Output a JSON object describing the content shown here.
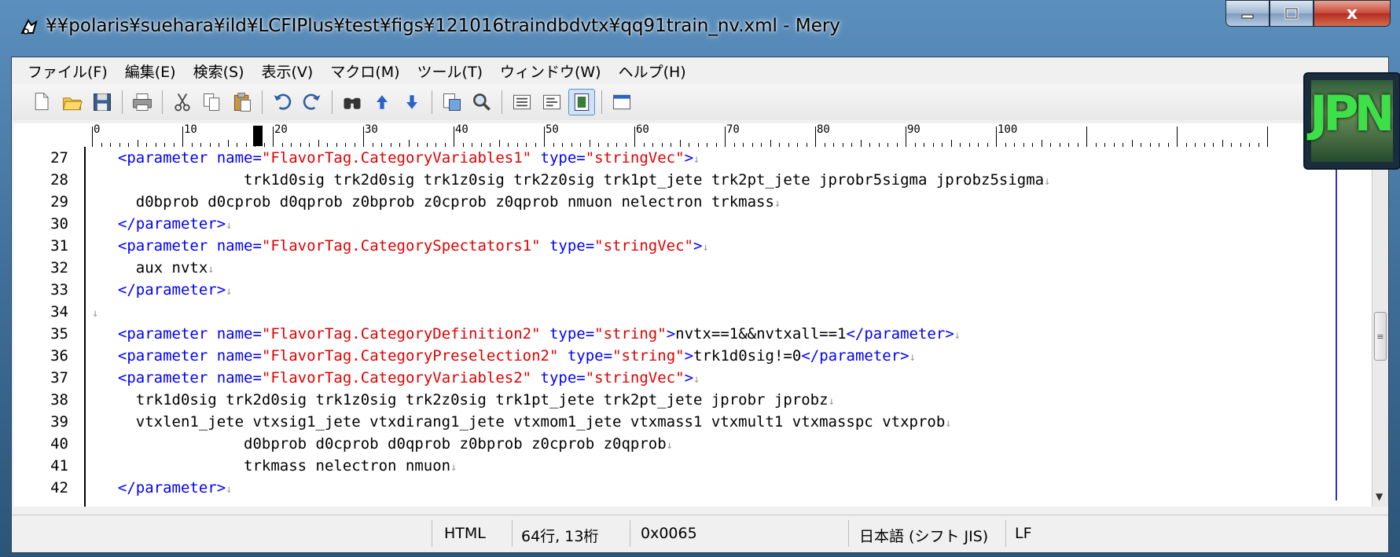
{
  "window": {
    "title": "¥¥polaris¥suehara¥ild¥LCFIPlus¥test¥figs¥121016traindbdvtx¥qq91train_nv.xml - Mery",
    "icon": "mery-app-icon"
  },
  "caption": {
    "close_label": "x"
  },
  "menu": {
    "items": [
      "ファイル(F)",
      "編集(E)",
      "検索(S)",
      "表示(V)",
      "マクロ(M)",
      "ツール(T)",
      "ウィンドウ(W)",
      "ヘルプ(H)"
    ]
  },
  "toolbar": {
    "groups": [
      [
        "new-file-icon",
        "open-folder-icon",
        "save-icon"
      ],
      [
        "print-icon"
      ],
      [
        "cut-icon",
        "copy-icon",
        "paste-icon"
      ],
      [
        "undo-icon",
        "redo-icon"
      ],
      [
        "find-icon",
        "find-prev-icon",
        "find-next-icon"
      ],
      [
        "replace-icon",
        "search-files-icon"
      ],
      [
        "wrap-none-icon",
        "wrap-window-icon",
        "wrap-ruler-icon"
      ],
      [
        "window-icon"
      ]
    ],
    "pressed": "wrap-ruler-icon"
  },
  "ruler": {
    "labels": [
      "0",
      "10",
      "20",
      "30",
      "40",
      "50",
      "60",
      "70",
      "80",
      "90",
      "100"
    ]
  },
  "editor": {
    "eol_glyph": "↓",
    "lines": [
      {
        "num": "27",
        "segs": [
          [
            "  ",
            ""
          ],
          [
            "<parameter name=",
            "tag"
          ],
          [
            "\"FlavorTag.CategoryVariables1\"",
            "str"
          ],
          [
            " type=",
            "tag"
          ],
          [
            "\"stringVec\"",
            "str"
          ],
          [
            ">",
            "tag"
          ]
        ]
      },
      {
        "num": "28",
        "segs": [
          [
            "                trk1d0sig trk2d0sig trk1z0sig trk2z0sig trk1pt_jete trk2pt_jete jprobr5sigma jprobz5sigma",
            ""
          ]
        ]
      },
      {
        "num": "29",
        "segs": [
          [
            "    d0bprob d0cprob d0qprob z0bprob z0cprob z0qprob nmuon nelectron trkmass",
            ""
          ]
        ]
      },
      {
        "num": "30",
        "segs": [
          [
            "  ",
            ""
          ],
          [
            "</parameter>",
            "tag"
          ]
        ]
      },
      {
        "num": "31",
        "segs": [
          [
            "  ",
            ""
          ],
          [
            "<parameter name=",
            "tag"
          ],
          [
            "\"FlavorTag.CategorySpectators1\"",
            "str"
          ],
          [
            " type=",
            "tag"
          ],
          [
            "\"stringVec\"",
            "str"
          ],
          [
            ">",
            "tag"
          ]
        ]
      },
      {
        "num": "32",
        "segs": [
          [
            "    aux nvtx",
            ""
          ]
        ]
      },
      {
        "num": "33",
        "segs": [
          [
            "  ",
            ""
          ],
          [
            "</parameter>",
            "tag"
          ]
        ]
      },
      {
        "num": "34",
        "segs": []
      },
      {
        "num": "35",
        "segs": [
          [
            "  ",
            ""
          ],
          [
            "<parameter name=",
            "tag"
          ],
          [
            "\"FlavorTag.CategoryDefinition2\"",
            "str"
          ],
          [
            " type=",
            "tag"
          ],
          [
            "\"string\"",
            "str"
          ],
          [
            ">",
            "tag"
          ],
          [
            "nvtx==1&&nvtxall==1",
            ""
          ],
          [
            "</parameter>",
            "tag"
          ]
        ]
      },
      {
        "num": "36",
        "segs": [
          [
            "  ",
            ""
          ],
          [
            "<parameter name=",
            "tag"
          ],
          [
            "\"FlavorTag.CategoryPreselection2\"",
            "str"
          ],
          [
            " type=",
            "tag"
          ],
          [
            "\"string\"",
            "str"
          ],
          [
            ">",
            "tag"
          ],
          [
            "trk1d0sig!=0",
            ""
          ],
          [
            "</parameter>",
            "tag"
          ]
        ]
      },
      {
        "num": "37",
        "segs": [
          [
            "  ",
            ""
          ],
          [
            "<parameter name=",
            "tag"
          ],
          [
            "\"FlavorTag.CategoryVariables2\"",
            "str"
          ],
          [
            " type=",
            "tag"
          ],
          [
            "\"stringVec\"",
            "str"
          ],
          [
            ">",
            "tag"
          ]
        ]
      },
      {
        "num": "38",
        "segs": [
          [
            "    trk1d0sig trk2d0sig trk1z0sig trk2z0sig trk1pt_jete trk2pt_jete jprobr jprobz",
            ""
          ]
        ]
      },
      {
        "num": "39",
        "segs": [
          [
            "    vtxlen1_jete vtxsig1_jete vtxdirang1_jete vtxmom1_jete vtxmass1 vtxmult1 vtxmasspc vtxprob",
            ""
          ]
        ]
      },
      {
        "num": "40",
        "segs": [
          [
            "                d0bprob d0cprob d0qprob z0bprob z0cprob z0qprob",
            ""
          ]
        ]
      },
      {
        "num": "41",
        "segs": [
          [
            "                trkmass nelectron nmuon",
            ""
          ]
        ]
      },
      {
        "num": "42",
        "segs": [
          [
            "  ",
            ""
          ],
          [
            "</parameter>",
            "tag"
          ]
        ]
      }
    ]
  },
  "status": {
    "mode": "HTML",
    "position": "64行, 13桁",
    "code": "0x0065",
    "encoding": "日本語 (シフト JIS)",
    "newline": "LF"
  },
  "colors": {
    "tag": "#0000ff",
    "string": "#e00000",
    "wrap_guide": "#3333cc"
  },
  "badge": {
    "text": "JPN"
  }
}
